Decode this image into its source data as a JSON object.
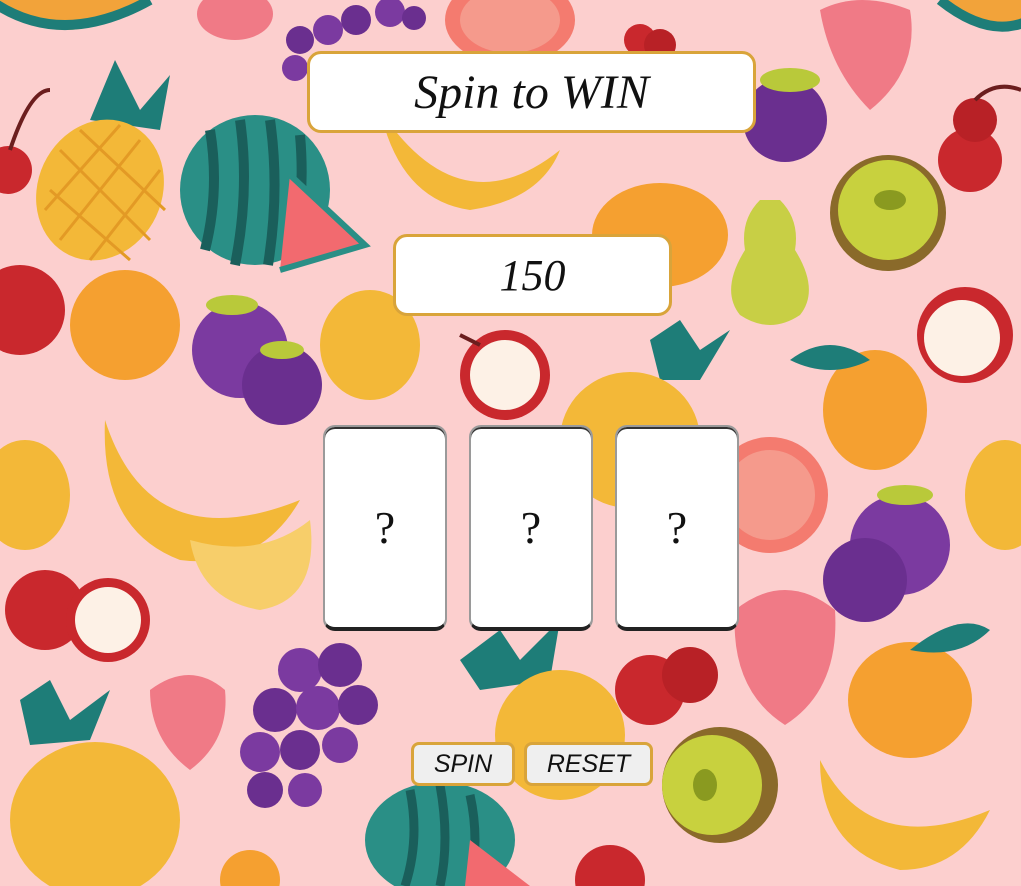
{
  "header": {
    "title": "Spin to WIN"
  },
  "score": {
    "value": "150"
  },
  "reels": [
    {
      "symbol": "?"
    },
    {
      "symbol": "?"
    },
    {
      "symbol": "?"
    }
  ],
  "controls": {
    "spin_label": "SPIN",
    "reset_label": "RESET"
  },
  "background": {
    "base_color": "#fccfce",
    "fruits": [
      "pineapple-icon",
      "watermelon-icon",
      "grapes-icon",
      "strawberry-icon",
      "cherry-icon",
      "apple-icon",
      "banana-icon",
      "orange-icon",
      "pear-icon",
      "kiwi-icon",
      "mangosteen-icon",
      "peach-icon",
      "lemon-icon",
      "grapefruit-icon"
    ]
  },
  "colors": {
    "panel_border": "#d9a43a",
    "panel_fill": "#ffffff",
    "button_fill": "#efefef"
  }
}
